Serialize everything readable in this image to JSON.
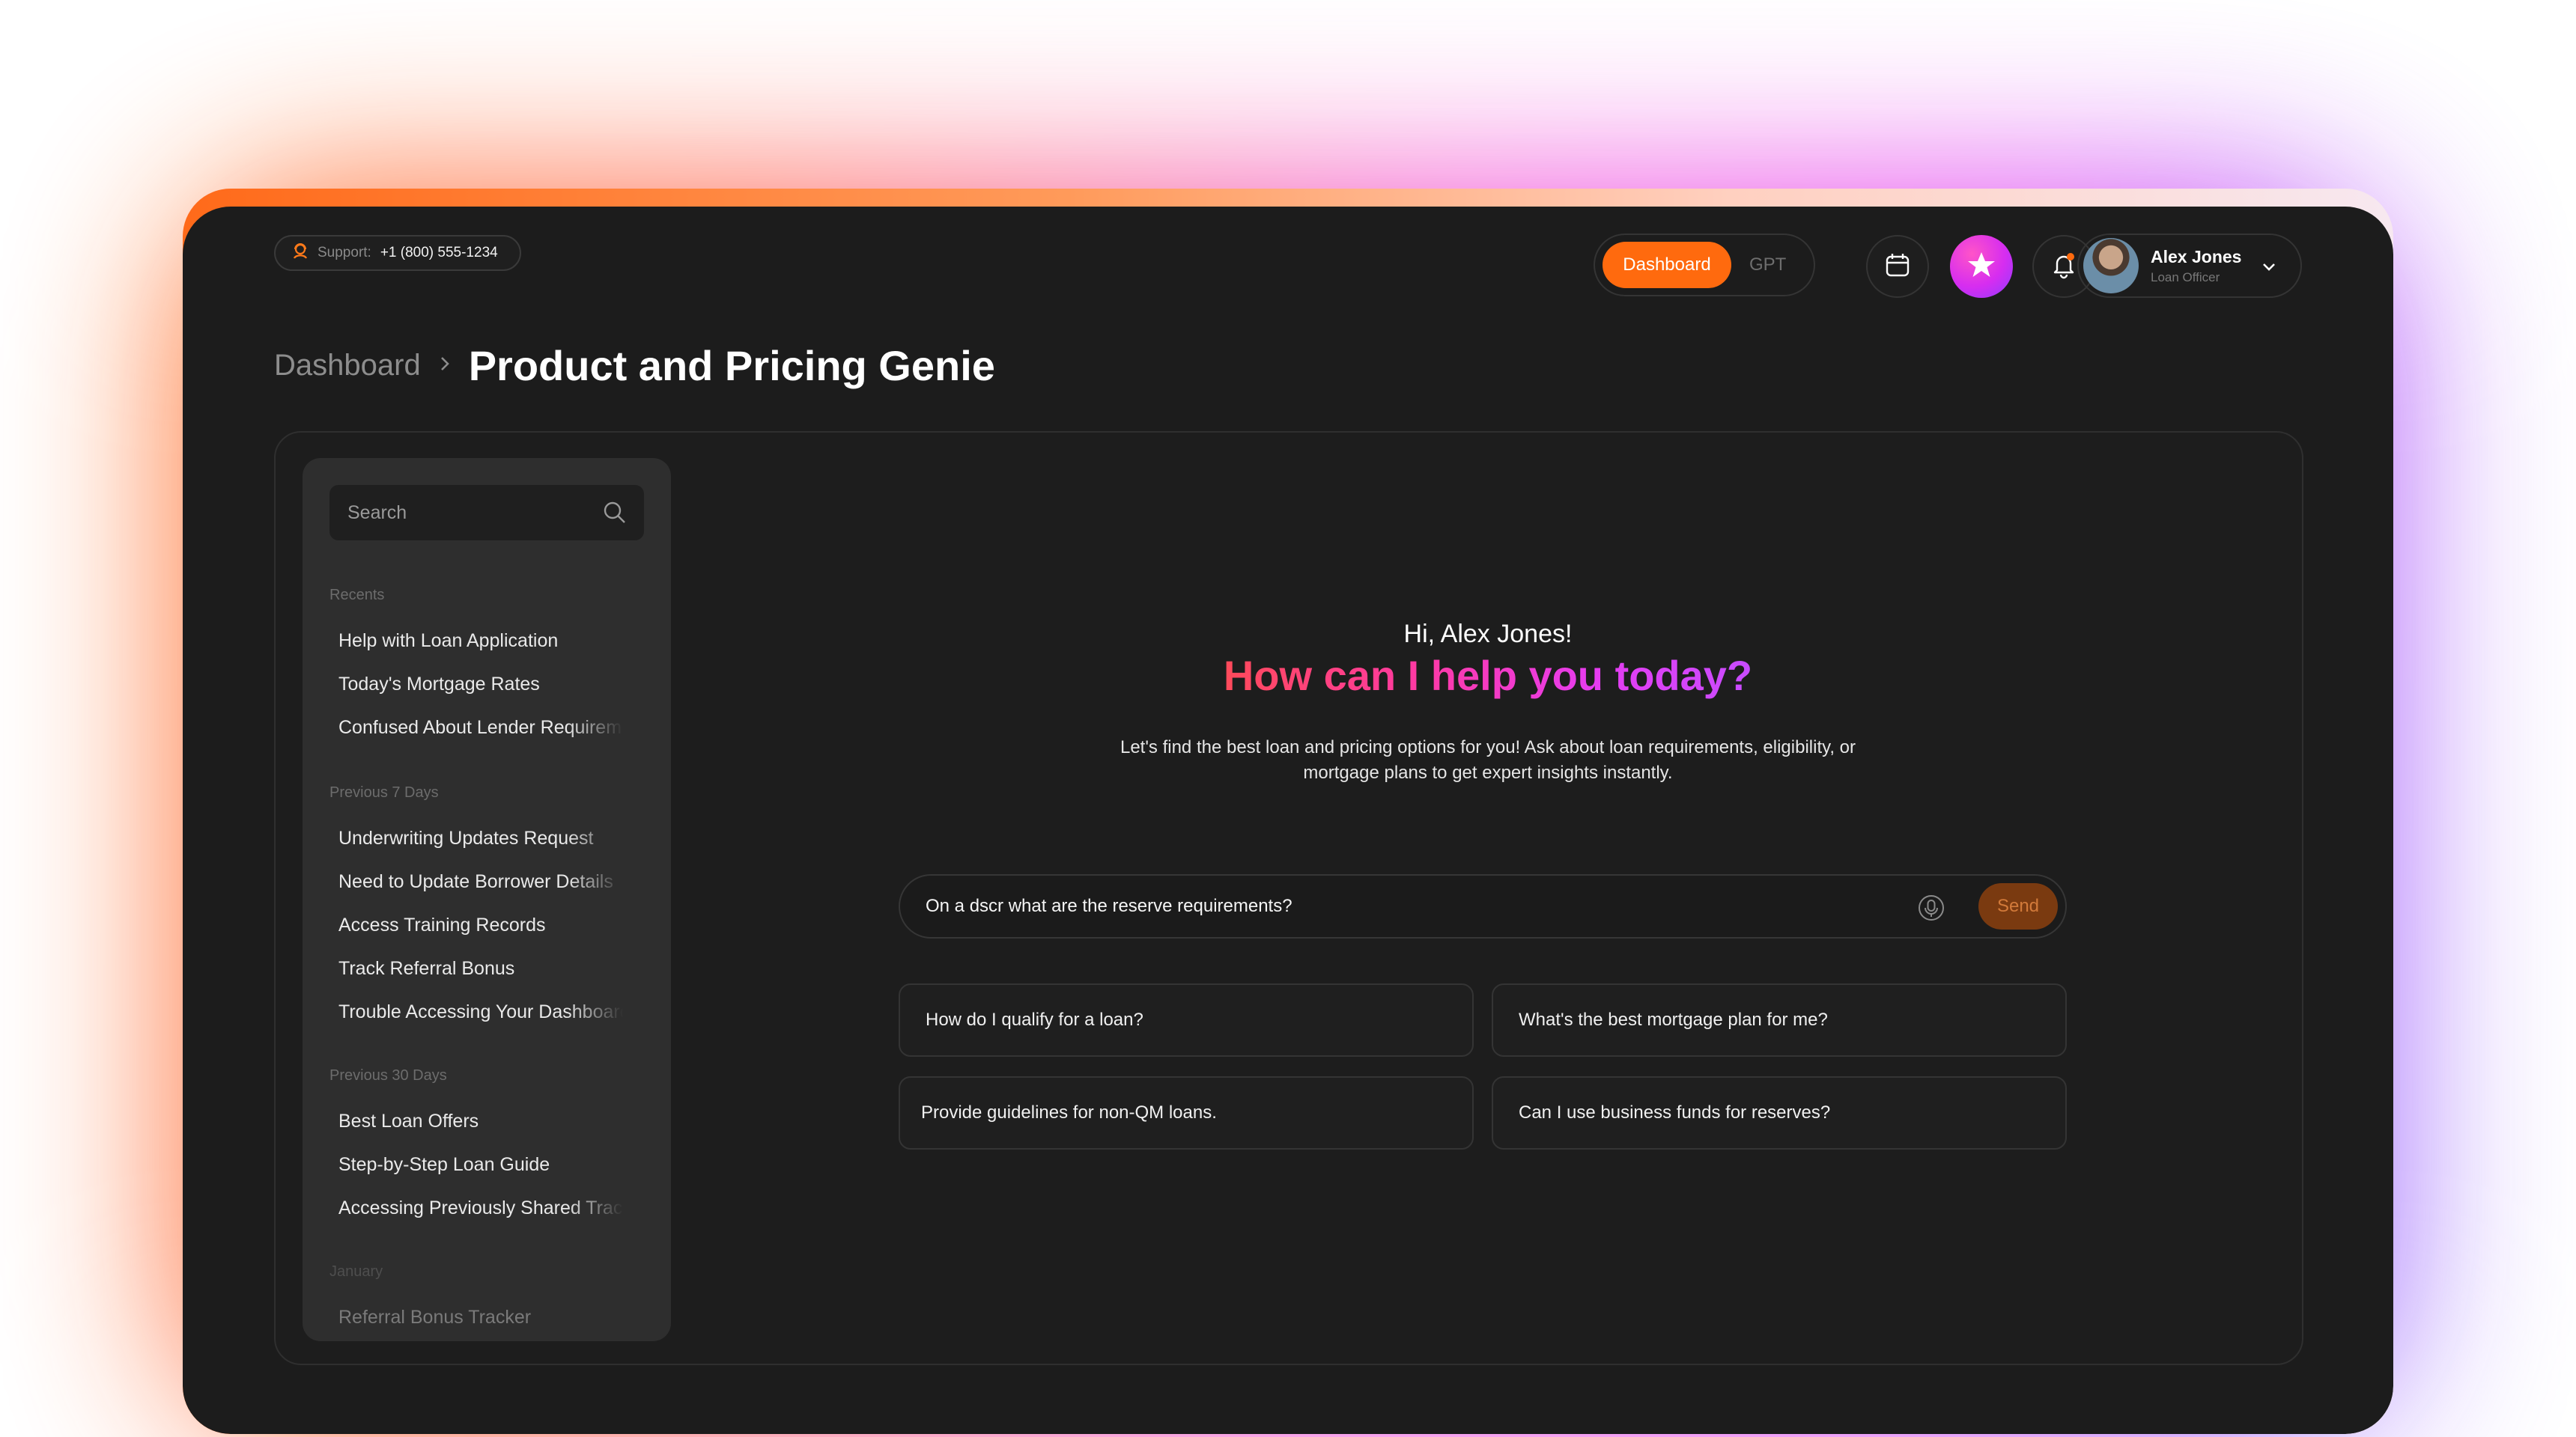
{
  "header": {
    "support_label": "Support:",
    "support_phone": "+1 (800) 555-1234",
    "tab_dashboard": "Dashboard",
    "tab_gpt": "GPT",
    "user_name": "Alex Jones",
    "user_role": "Loan Officer"
  },
  "breadcrumb": {
    "parent": "Dashboard",
    "current": "Product and Pricing Genie"
  },
  "sidebar": {
    "search_placeholder": "Search",
    "sections": [
      {
        "title": "Recents",
        "items": [
          "Help with Loan Application",
          "Today's Mortgage Rates",
          "Confused About Lender Requirements"
        ]
      },
      {
        "title": "Previous 7 Days",
        "items": [
          "Underwriting Updates Request",
          "Need to Update Borrower Details",
          "Access Training Records",
          "Track Referral Bonus",
          "Trouble Accessing Your Dashboard"
        ]
      },
      {
        "title": "Previous 30 Days",
        "items": [
          "Best Loan Offers",
          "Step-by-Step Loan Guide",
          "Accessing Previously Shared Tracker"
        ]
      },
      {
        "title": "January",
        "items": [
          "Referral Bonus Tracker"
        ]
      }
    ]
  },
  "main": {
    "greeting": "Hi, Alex Jones!",
    "headline": "How can I help you today?",
    "description": "Let's find the best loan and pricing options for you! Ask about loan requirements, eligibility, or mortgage plans to get expert insights instantly.",
    "prompt_value": "On a dscr what are the reserve requirements?",
    "send_label": "Send",
    "suggestions": [
      "How do I qualify for a loan?",
      "What's the best mortgage plan for me?",
      "Provide guidelines for non-QM loans.",
      "Can I use business funds for reserves?"
    ]
  },
  "colors": {
    "accent": "#ff6a0e",
    "background": "#1c1c1c",
    "sidebar": "#2e2e2e"
  }
}
